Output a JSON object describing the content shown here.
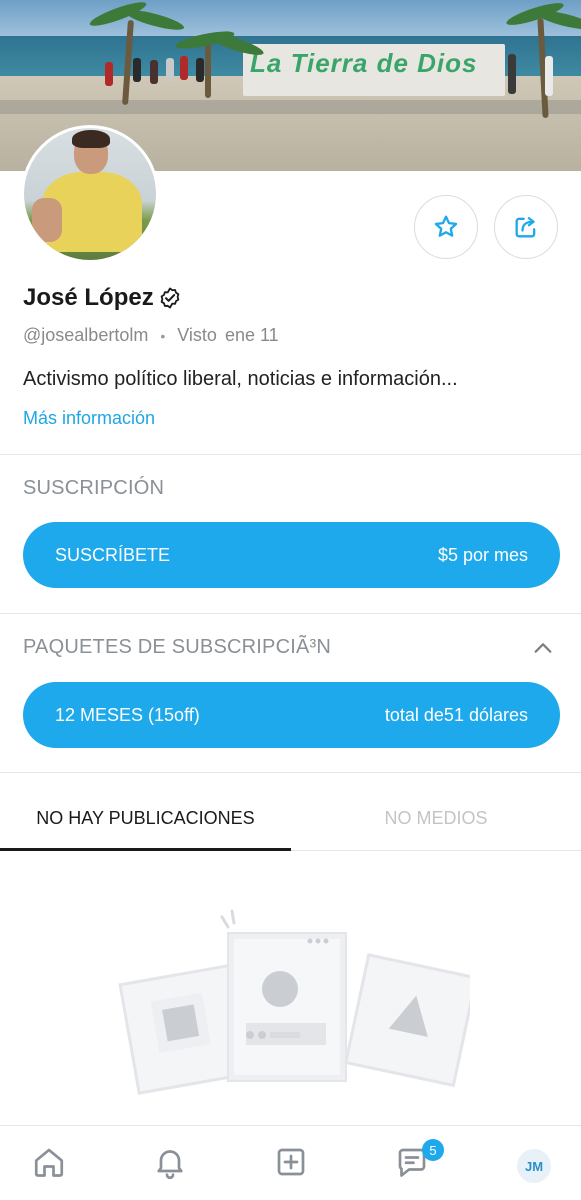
{
  "profile": {
    "name": "José López",
    "handle": "@josealbertolm",
    "last_seen_label": "Visto",
    "last_seen_date": "ene 11",
    "bio": "Activismo político liberal, noticias e información...",
    "more_info": "Más información",
    "cover_sign_text": "La Tierra de Dios"
  },
  "actions": {
    "favorite_icon": "star-icon",
    "share_icon": "share-icon"
  },
  "subscription": {
    "title": "SUSCRIPCIÓN",
    "button_label": "SUSCRÍBETE",
    "button_price": "$5 por mes"
  },
  "bundles": {
    "title": "PAQUETES DE SUBSCRIPCIÃ³N",
    "bundle_label": "12 MESES (15off)",
    "bundle_price": "total de51 dólares"
  },
  "tabs": {
    "posts": "NO HAY PUBLICACIONES",
    "media": "NO MEDIOS"
  },
  "bottom_nav": {
    "messages_badge": "5",
    "me_initials": "JM"
  },
  "colors": {
    "accent": "#1ea9ec",
    "muted_text": "#8a9098"
  }
}
